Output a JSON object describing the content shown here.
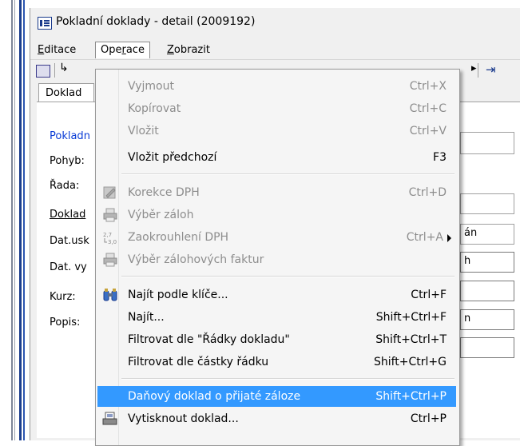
{
  "window": {
    "title": "Pokladní doklady - detail (2009192)"
  },
  "menubar": {
    "editace": "Editace",
    "operace": "Operace",
    "zobrazit": "Zobrazit"
  },
  "tabs": {
    "doklad": "Doklad"
  },
  "form": {
    "labels": {
      "pokladna": "Pokladn",
      "pohyb": "Pohyb:",
      "rada": "Řada:",
      "doklad": "Doklad",
      "dat_usk": "Dat.usk",
      "dat_vy": "Dat. vy",
      "kurz": "Kurz:",
      "popis": "Popis:"
    },
    "fragments": {
      "doklad_right": "án",
      "dat_usk_right": "h",
      "kurz_right": "n"
    }
  },
  "menu": {
    "items": [
      {
        "label": "Vyjmout",
        "shortcut": "Ctrl+X",
        "enabled": false,
        "icon": ""
      },
      {
        "label": "Kopírovat",
        "shortcut": "Ctrl+C",
        "enabled": false,
        "icon": ""
      },
      {
        "label": "Vložit",
        "shortcut": "Ctrl+V",
        "enabled": false,
        "icon": ""
      },
      {
        "label": "Vložit předchozí",
        "shortcut": "F3",
        "enabled": true,
        "icon": ""
      },
      {
        "label": "Korekce DPH",
        "shortcut": "Ctrl+D",
        "enabled": false,
        "icon": "edit-icon"
      },
      {
        "label": "Výběr záloh",
        "shortcut": "",
        "enabled": false,
        "icon": "printer-icon"
      },
      {
        "label": "Zaokrouhlení DPH",
        "shortcut": "Ctrl+A",
        "enabled": false,
        "icon": "rounding-icon",
        "submenu": true
      },
      {
        "label": "Výběr zálohových faktur",
        "shortcut": "",
        "enabled": false,
        "icon": "printer-icon"
      },
      {
        "label": "Najít podle klíče...",
        "shortcut": "Ctrl+F",
        "enabled": true,
        "icon": "binoculars-icon"
      },
      {
        "label": "Najít...",
        "shortcut": "Shift+Ctrl+F",
        "enabled": true,
        "icon": ""
      },
      {
        "label": "Filtrovat dle \"Řádky dokladu\"",
        "shortcut": "Shift+Ctrl+T",
        "enabled": true,
        "icon": ""
      },
      {
        "label": "Filtrovat dle částky řádku",
        "shortcut": "Shift+Ctrl+G",
        "enabled": true,
        "icon": ""
      },
      {
        "label": "Daňový doklad o přijaté záloze",
        "shortcut": "Shift+Ctrl+P",
        "enabled": true,
        "icon": "",
        "selected": true
      },
      {
        "label": "Vytisknout doklad...",
        "shortcut": "Ctrl+P",
        "enabled": true,
        "icon": "print-document-icon"
      }
    ]
  },
  "colors": {
    "highlight": "#3399ff",
    "disabled_text": "#8d8d8d",
    "link_label": "#0a3cd6"
  }
}
